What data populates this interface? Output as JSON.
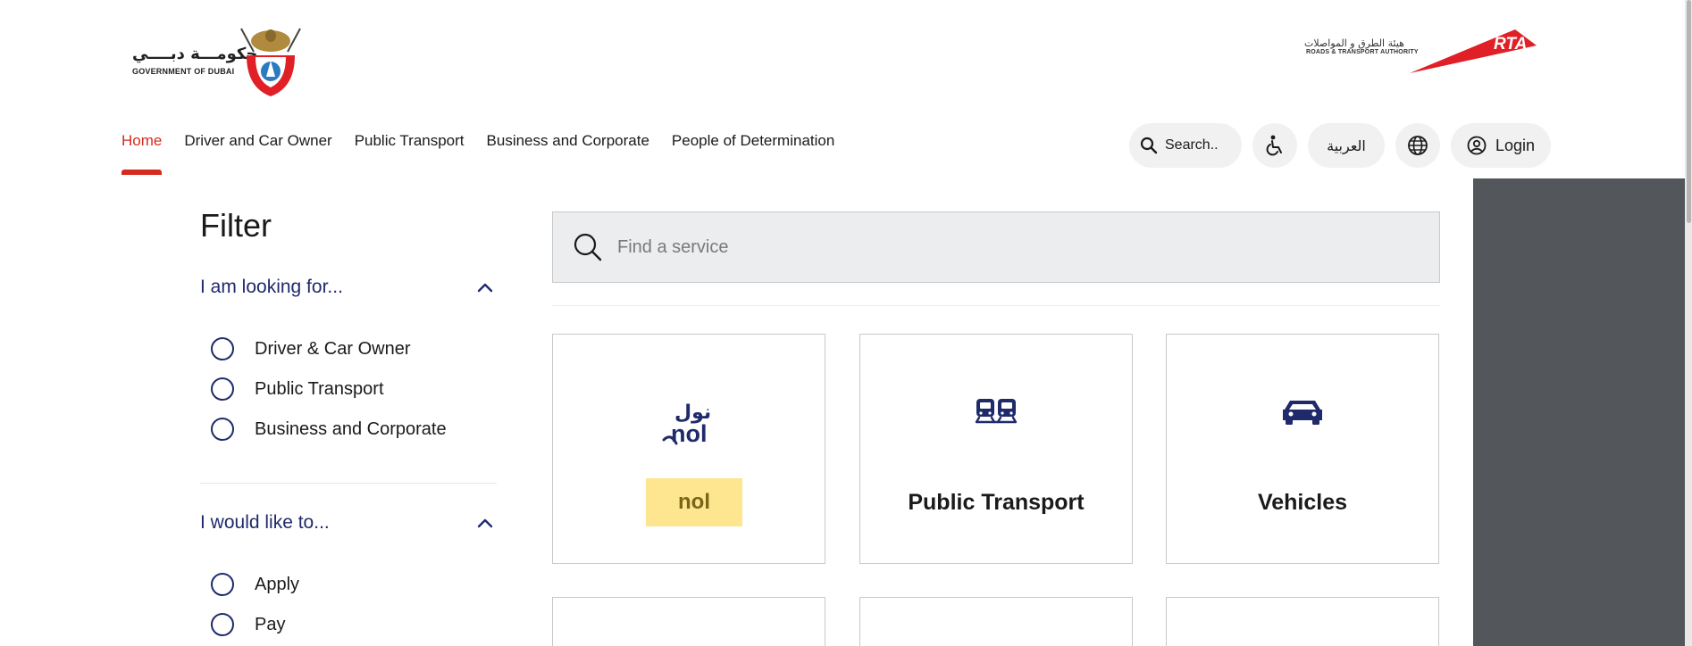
{
  "header": {
    "gov_logo_ar": "حكومـــة دبــــي",
    "gov_logo_en": "GOVERNMENT OF DUBAI",
    "rta_logo_ar": "هيئة الطرق و المواصلات",
    "rta_logo_en": "ROADS & TRANSPORT AUTHORITY",
    "rta_mark": "RTA"
  },
  "nav": {
    "items": [
      {
        "label": "Home",
        "active": true
      },
      {
        "label": "Driver and Car Owner",
        "active": false
      },
      {
        "label": "Public Transport",
        "active": false
      },
      {
        "label": "Business and Corporate",
        "active": false
      },
      {
        "label": "People of Determination",
        "active": false
      }
    ],
    "search_label": "Search..",
    "arabic_label": "العربية",
    "login_label": "Login"
  },
  "filter": {
    "title": "Filter",
    "sections": [
      {
        "heading": "I am looking for...",
        "options": [
          "Driver & Car Owner",
          "Public Transport",
          "Business and Corporate"
        ]
      },
      {
        "heading": "I would like to...",
        "options": [
          "Apply",
          "Pay"
        ]
      }
    ]
  },
  "main": {
    "search_placeholder": "Find a service",
    "cards": [
      {
        "label": "nol",
        "icon": "nol-logo-icon",
        "icon_ar": "نول",
        "icon_en": "nol"
      },
      {
        "label": "Public Transport",
        "icon": "tram-icon"
      },
      {
        "label": "Vehicles",
        "icon": "car-icon"
      }
    ]
  },
  "colors": {
    "accent_red": "#d52b1e",
    "navy": "#1f2a6b",
    "nol_highlight": "#fde68f",
    "side_panel": "#53565a"
  }
}
